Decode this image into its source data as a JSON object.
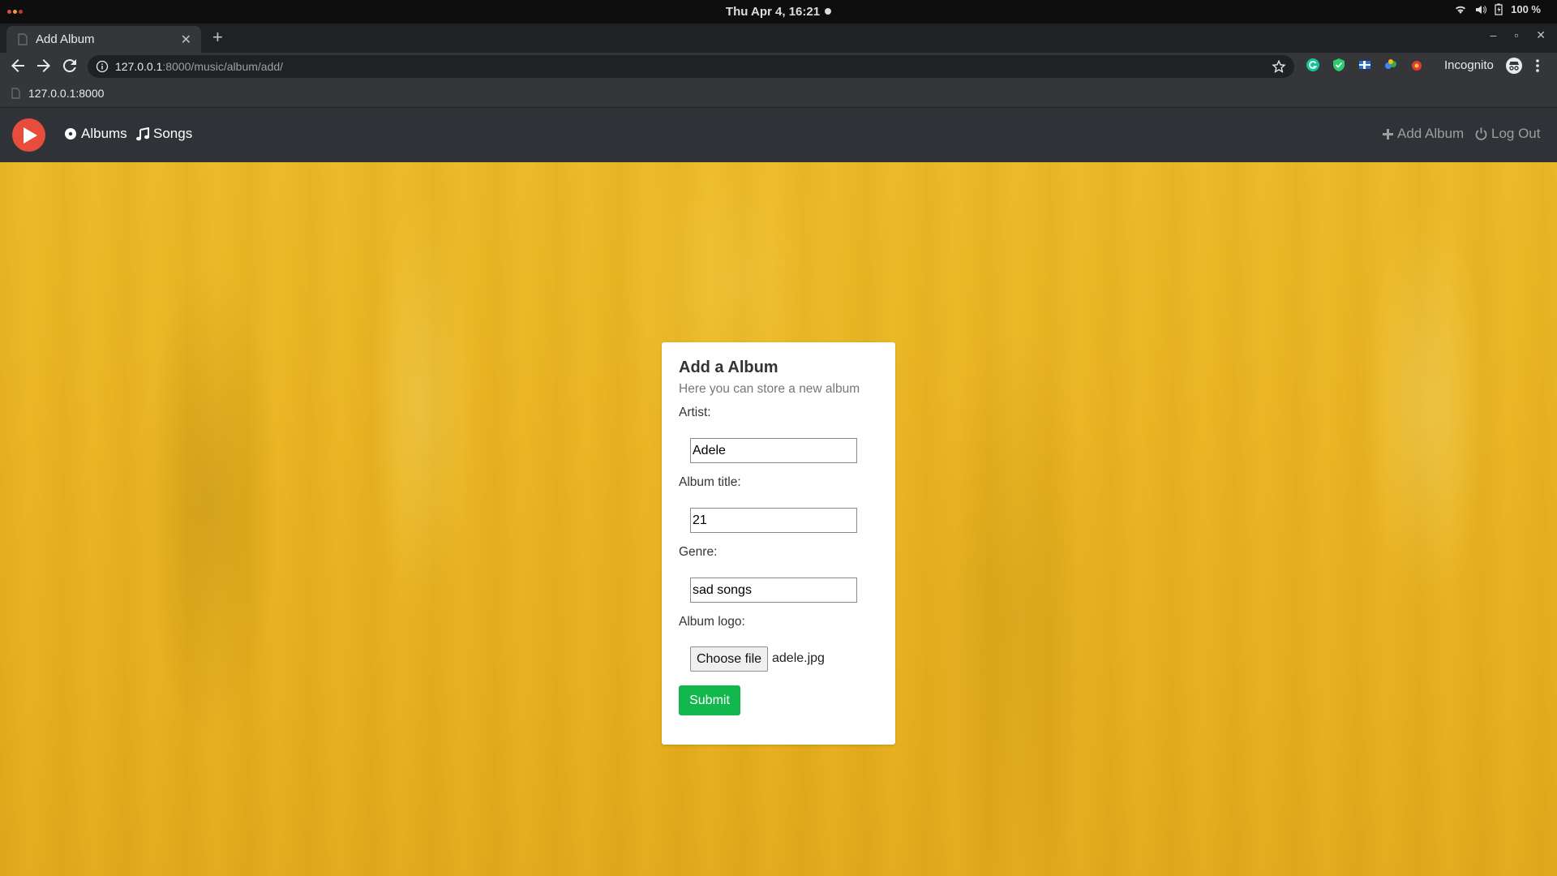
{
  "os": {
    "clock": "Thu Apr  4, 16:21",
    "battery": "100 %"
  },
  "browser": {
    "tab_title": "Add Album",
    "url_host": "127.0.0.1",
    "url_path": ":8000/music/album/add/",
    "incognito_label": "Incognito",
    "bookmark_label": "127.0.0.1:8000"
  },
  "site_nav": {
    "albums_label": "Albums",
    "songs_label": "Songs",
    "add_album_label": "Add Album",
    "logout_label": "Log Out"
  },
  "form": {
    "title": "Add a Album",
    "subtitle": "Here you can store a new album",
    "artist_label": "Artist:",
    "artist_value": "Adele",
    "album_title_label": "Album title:",
    "album_title_value": "21",
    "genre_label": "Genre:",
    "genre_value": "sad songs",
    "logo_label": "Album logo:",
    "choose_file_label": "Choose file",
    "file_name": "adele.jpg",
    "submit_label": "Submit"
  },
  "colors": {
    "accent_green": "#12b84d",
    "brand_red": "#e74c3c",
    "navbar": "#2f3237",
    "background_yellow": "#e8b21f"
  }
}
